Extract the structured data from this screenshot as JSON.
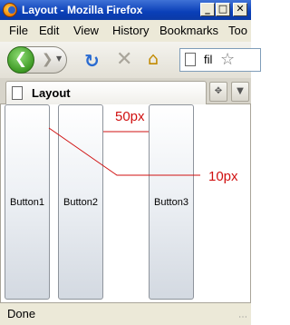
{
  "window": {
    "title": "Layout - Mozilla Firefox",
    "controls": [
      "_",
      "□",
      "✕"
    ]
  },
  "menubar": {
    "items": [
      "File",
      "Edit",
      "View",
      "History",
      "Bookmarks",
      "Too"
    ]
  },
  "navbar": {
    "back_icon": "back-arrow-icon",
    "forward_icon": "forward-arrow-icon",
    "reload_icon": "reload-icon",
    "stop_icon": "stop-icon",
    "home_icon": "home-icon",
    "url_text": "fil"
  },
  "tabbar": {
    "tab_label": "Layout"
  },
  "content": {
    "buttons": [
      "Button1",
      "Button2",
      "Button3"
    ],
    "annotations": {
      "gap_label": "50px",
      "margin_label": "10px",
      "color": "#d01010"
    }
  },
  "status": {
    "text": "Done"
  }
}
